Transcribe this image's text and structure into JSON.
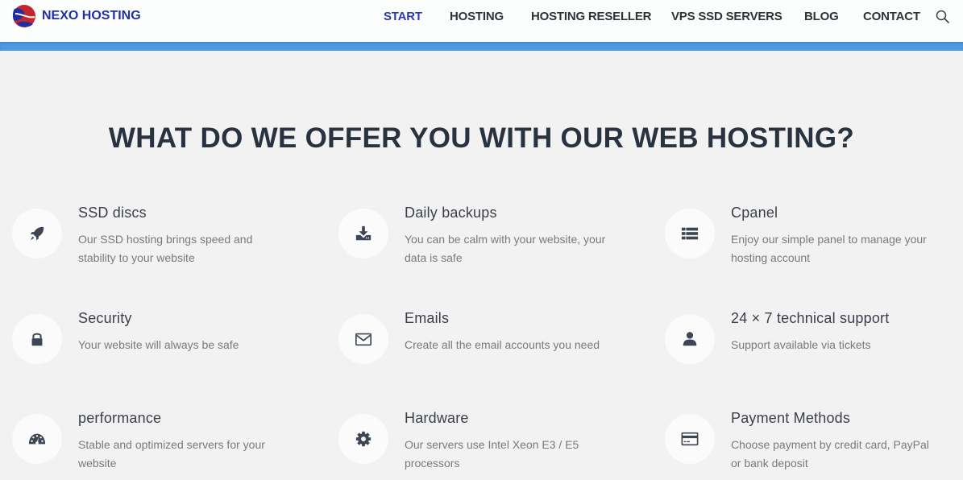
{
  "header": {
    "brand": "NEXO HOSTING",
    "logo_icon": "globe-logo-icon",
    "nav": [
      {
        "label": "START",
        "active": true
      },
      {
        "label": "HOSTING",
        "active": false
      },
      {
        "label": "HOSTING RESELLER",
        "active": false
      },
      {
        "label": "VPS SSD SERVERS",
        "active": false
      },
      {
        "label": "BLOG",
        "active": false
      },
      {
        "label": "CONTACT",
        "active": false
      }
    ],
    "search_icon": "search-icon"
  },
  "colors": {
    "brand": "#2230a8",
    "accent_band": "#4d9ae3",
    "heading": "#293340",
    "background": "#f2f2f2"
  },
  "section": {
    "title": "WHAT DO WE OFFER YOU WITH OUR WEB HOSTING?"
  },
  "features": [
    {
      "icon": "rocket-icon",
      "title": "SSD discs",
      "description": "Our SSD hosting brings speed and stability to your website"
    },
    {
      "icon": "download-icon",
      "title": "Daily backups",
      "description": "You can be calm with your website, your data is safe"
    },
    {
      "icon": "list-icon",
      "title": "Cpanel",
      "description": "Enjoy our simple panel to manage your hosting account"
    },
    {
      "icon": "lock-icon",
      "title": "Security",
      "description": "Your website will always be safe"
    },
    {
      "icon": "envelope-icon",
      "title": "Emails",
      "description": "Create all the email accounts you need"
    },
    {
      "icon": "user-icon",
      "title": "24 × 7 technical support",
      "description": "Support available via tickets"
    },
    {
      "icon": "dashboard-icon",
      "title": "performance",
      "description": "Stable and optimized servers for your website"
    },
    {
      "icon": "gear-icon",
      "title": "Hardware",
      "description": "Our servers use Intel Xeon E3 / E5 processors"
    },
    {
      "icon": "credit-card-icon",
      "title": "Payment Methods",
      "description": "Choose payment by credit card, PayPal or bank deposit"
    }
  ]
}
